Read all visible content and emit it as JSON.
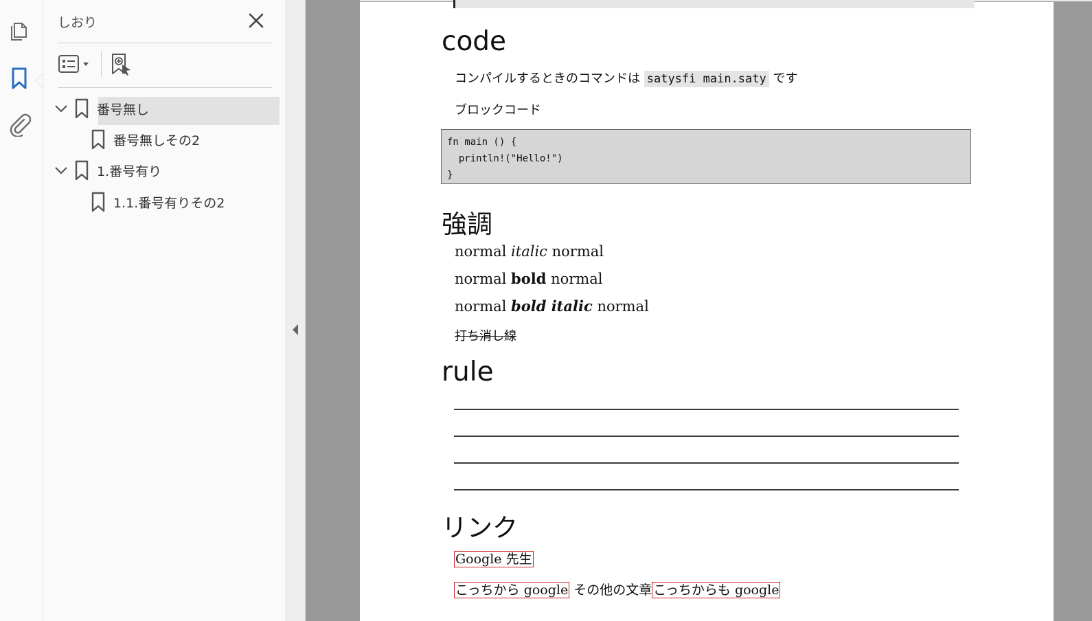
{
  "sidebar_rail": {
    "icons": [
      "pages-icon",
      "bookmark-icon",
      "attachment-icon"
    ]
  },
  "bookmarks_panel": {
    "title": "しおり",
    "items": [
      {
        "label": "番号無し",
        "level": 0,
        "expanded": true
      },
      {
        "label": "番号無しその2",
        "level": 1
      },
      {
        "label": "1.番号有り",
        "level": 0,
        "expanded": true
      },
      {
        "label": "1.1.番号有りその2",
        "level": 1
      }
    ]
  },
  "document": {
    "code_section": {
      "heading": "code",
      "command_prefix": "コンパイルするときのコマンドは",
      "command": "satysfi main.saty",
      "command_suffix": "です",
      "block_label": "ブロックコード",
      "code_lines": [
        "fn main () {",
        "  println!(\"Hello!\")",
        "}"
      ]
    },
    "emphasis_section": {
      "heading": "強調",
      "normal": "normal",
      "italic": "italic",
      "bold": "bold",
      "bold_italic": "bold italic",
      "strikethrough": "打ち消し線"
    },
    "rule_section": {
      "heading": "rule"
    },
    "link_section": {
      "heading": "リンク",
      "link1": "Google 先生",
      "link2": "こっちから google",
      "middle_text": "その他の文章",
      "link3": "こっちからも google"
    }
  },
  "colors": {
    "accent": "#2a6fbf",
    "link_border": "#cc1f1f",
    "doc_background": "#999999"
  }
}
